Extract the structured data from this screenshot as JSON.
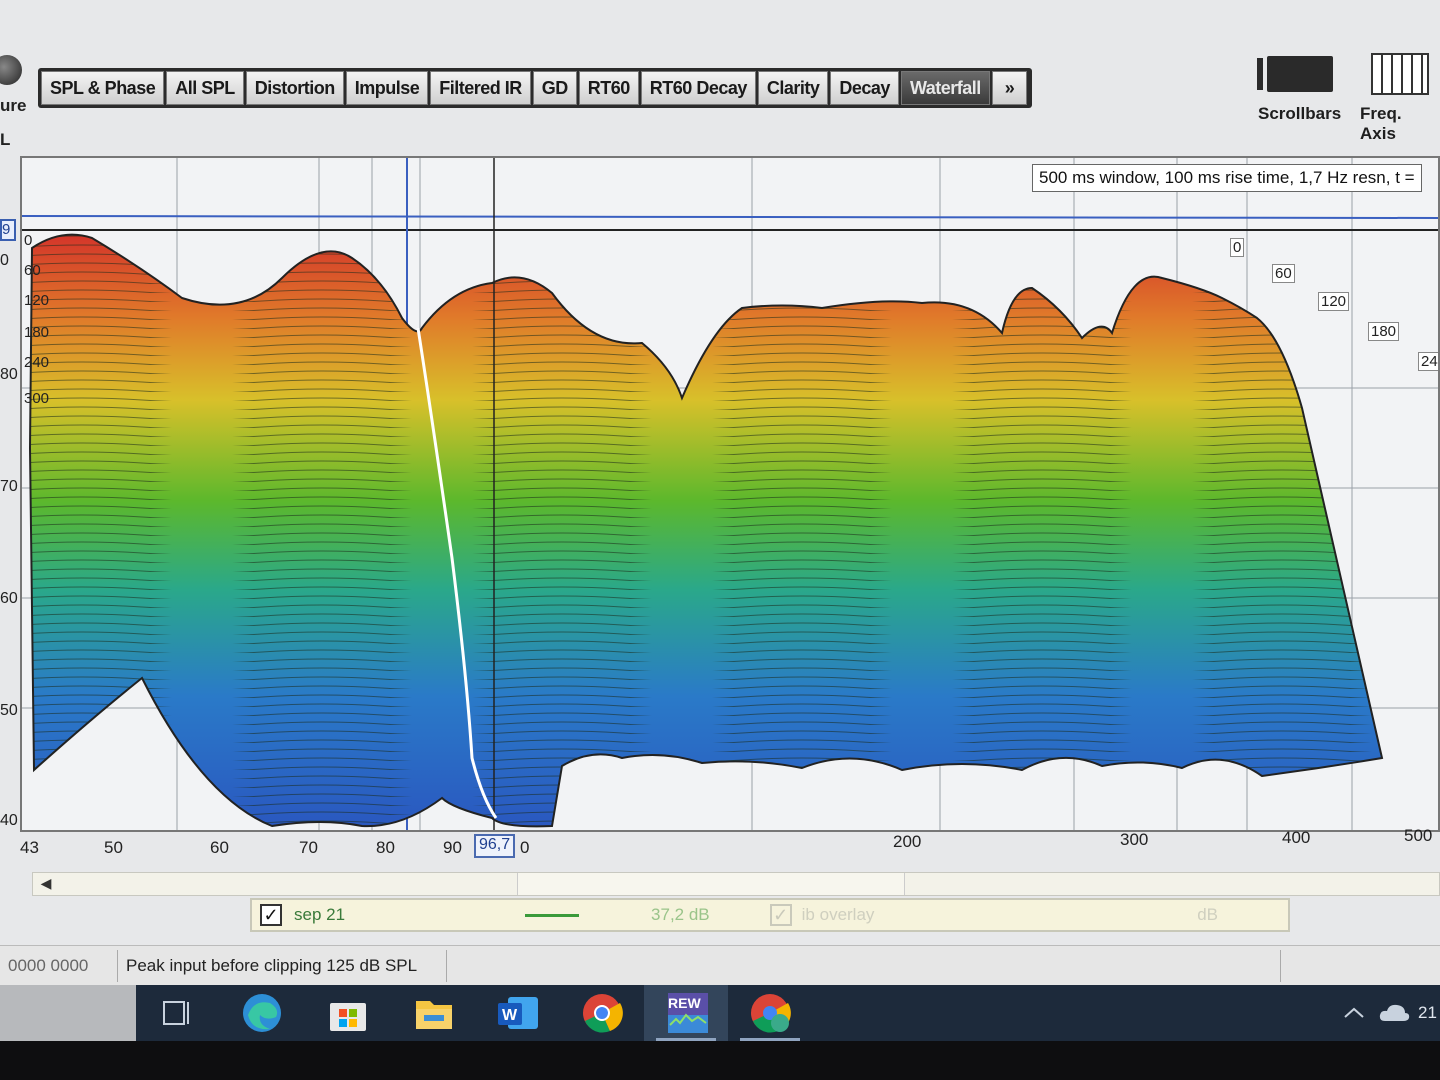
{
  "toolbar": {
    "capture_label": "ure",
    "l_label": "L",
    "tabs": [
      "SPL & Phase",
      "All SPL",
      "Distortion",
      "Impulse",
      "Filtered IR",
      "GD",
      "RT60",
      "RT60 Decay",
      "Clarity",
      "Decay",
      "Waterfall"
    ],
    "active_tab": "Waterfall",
    "more": "»",
    "scrollbars_label": "Scrollbars",
    "freq_axis_label": "Freq. Axis"
  },
  "graph": {
    "info_text": "500 ms window, 100 ms rise time,  1,7 Hz resn, t =",
    "y_labels": [
      "9",
      "0",
      "80",
      "70",
      "60",
      "50",
      "40"
    ],
    "x_labels": [
      "43",
      "50",
      "60",
      "70",
      "80",
      "90",
      "200",
      "300",
      "400",
      "500"
    ],
    "cursor_freq": "96,7",
    "cursor_suffix": "0",
    "time_left": [
      "0",
      "60",
      "120",
      "180",
      "240",
      "300"
    ],
    "time_right": [
      "0",
      "60",
      "120",
      "180",
      "24"
    ]
  },
  "legend": {
    "name": "sep 21",
    "value": "37,2 dB",
    "overlay_label": "ib overlay",
    "overlay_unit": "dB",
    "series_color": "#3a9a3a"
  },
  "status": {
    "left": "0000 0000",
    "message": "Peak input before clipping 125 dB SPL"
  },
  "taskbar": {
    "rew_label": "REW",
    "clock": "21"
  }
}
